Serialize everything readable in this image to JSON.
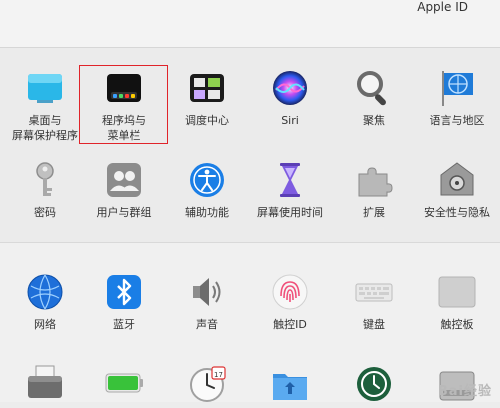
{
  "header": {
    "apple_id_label": "Apple ID"
  },
  "panes_row1": [
    {
      "label": "桌面与\n屏幕保护程序",
      "icon": "desktop-screensaver-icon"
    },
    {
      "label": "程序坞与\n菜单栏",
      "icon": "dock-menubar-icon"
    },
    {
      "label": "调度中心",
      "icon": "mission-control-icon"
    },
    {
      "label": "Siri",
      "icon": "siri-icon"
    },
    {
      "label": "聚焦",
      "icon": "spotlight-icon"
    },
    {
      "label": "语言与地区",
      "icon": "language-region-icon"
    }
  ],
  "panes_row2": [
    {
      "label": "密码",
      "icon": "passwords-icon"
    },
    {
      "label": "用户与群组",
      "icon": "users-groups-icon"
    },
    {
      "label": "辅助功能",
      "icon": "accessibility-icon"
    },
    {
      "label": "屏幕使用时间",
      "icon": "screen-time-icon"
    },
    {
      "label": "扩展",
      "icon": "extensions-icon"
    },
    {
      "label": "安全性与隐私",
      "icon": "security-privacy-icon"
    }
  ],
  "panes_row3": [
    {
      "label": "网络",
      "icon": "network-icon"
    },
    {
      "label": "蓝牙",
      "icon": "bluetooth-icon"
    },
    {
      "label": "声音",
      "icon": "sound-icon"
    },
    {
      "label": "触控ID",
      "icon": "touch-id-icon"
    },
    {
      "label": "键盘",
      "icon": "keyboard-icon"
    },
    {
      "label": "触控板",
      "icon": "trackpad-icon"
    }
  ],
  "partial_icons": [
    "printer-icon",
    "battery-icon",
    "date-time-icon",
    "sharing-folder-icon",
    "time-machine-icon",
    "startup-disk-icon"
  ],
  "watermark": "Bai经验"
}
